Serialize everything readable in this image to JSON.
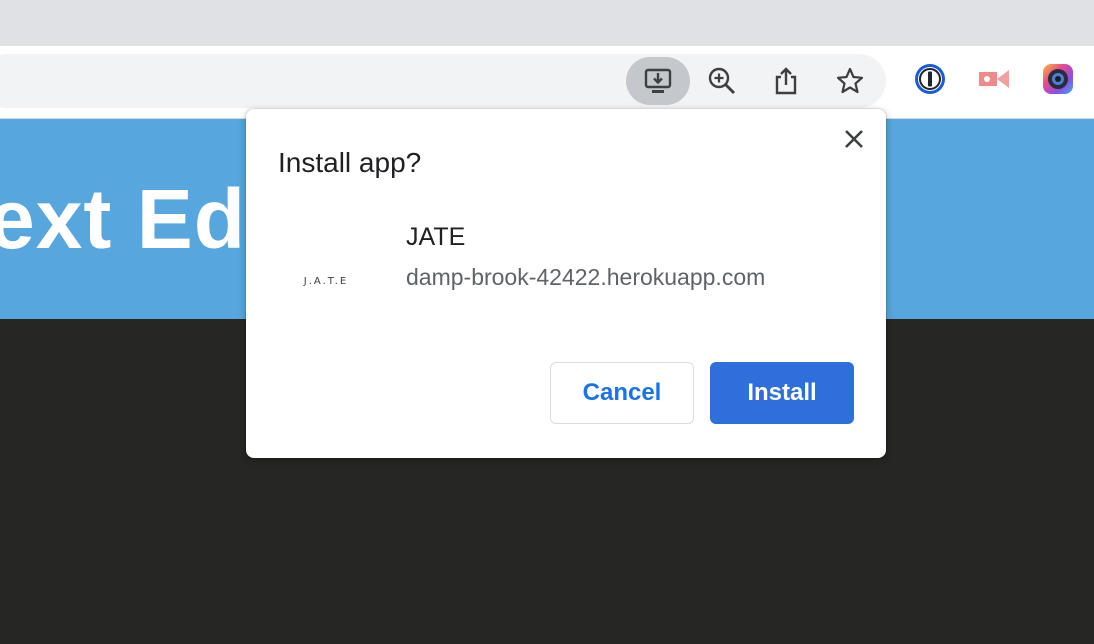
{
  "browser": {
    "toolbar_icons": [
      "install-app-icon",
      "zoom-icon",
      "share-icon",
      "bookmark-star-icon"
    ],
    "extension_icons": [
      "1password-icon",
      "screencast-icon",
      "color-camera-icon"
    ]
  },
  "page": {
    "hero_title": "ext Edi"
  },
  "dialog": {
    "title": "Install app?",
    "app_logo_text": "J.A.T.E",
    "app_name": "JATE",
    "app_origin": "damp-brook-42422.herokuapp.com",
    "cancel_label": "Cancel",
    "install_label": "Install"
  },
  "colors": {
    "hero_bg": "#57a6dd",
    "page_bg": "#262624",
    "install_button": "#2f6fdc",
    "link_blue": "#1a73e8"
  }
}
